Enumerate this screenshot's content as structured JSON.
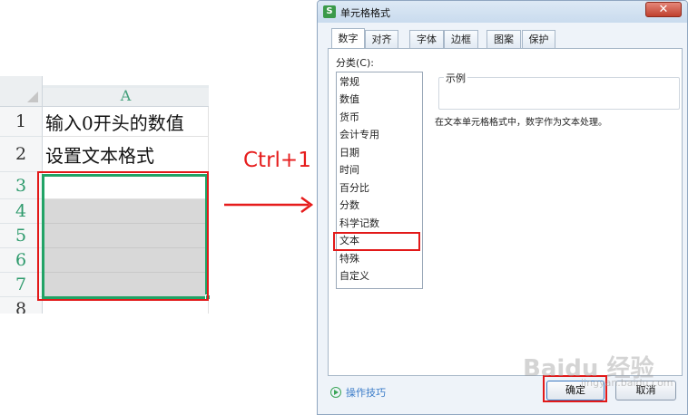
{
  "sheet": {
    "column_header": "A",
    "rows": [
      {
        "num": "1",
        "text": "输入0开头的数值"
      },
      {
        "num": "2",
        "text": "设置文本格式"
      },
      {
        "num": "3",
        "text": ""
      },
      {
        "num": "4",
        "text": ""
      },
      {
        "num": "5",
        "text": ""
      },
      {
        "num": "6",
        "text": ""
      },
      {
        "num": "7",
        "text": ""
      },
      {
        "num": "8",
        "text": ""
      }
    ]
  },
  "shortcut_label": "Ctrl+1",
  "dialog": {
    "app_icon": "S",
    "title": "单元格格式",
    "close": "✕",
    "tabs": [
      "数字",
      "对齐",
      "字体",
      "边框",
      "图案",
      "保护"
    ],
    "active_tab": "数字",
    "category_label": "分类(C):",
    "categories": [
      "常规",
      "数值",
      "货币",
      "会计专用",
      "日期",
      "时间",
      "百分比",
      "分数",
      "科学记数",
      "文本",
      "特殊",
      "自定义"
    ],
    "selected_category": "文本",
    "example_label": "示例",
    "description": "在文本单元格格式中，数字作为文本处理。",
    "tips_link": "操作技巧",
    "ok": "确定",
    "cancel": "取消"
  },
  "watermark": "Baidu 经验",
  "watermark_sub": "jingyan.baidu.com",
  "colors": {
    "highlight_red": "#e21919",
    "selection_green": "#21a366",
    "shortcut_red": "#e61c1c"
  }
}
